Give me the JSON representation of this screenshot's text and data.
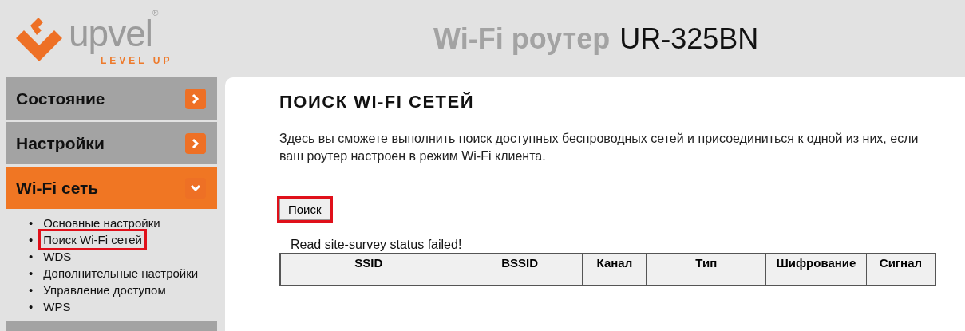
{
  "header": {
    "logo": {
      "name": "upvel",
      "mark": "®",
      "tagline": "LEVEL UP"
    },
    "title": "Wi-Fi роутер",
    "model": "UR-325BN"
  },
  "sidebar": {
    "items": [
      {
        "label": "Состояние",
        "selected": false,
        "expanded": false
      },
      {
        "label": "Настройки",
        "selected": false,
        "expanded": false
      },
      {
        "label": "Wi-Fi сеть",
        "selected": true,
        "expanded": true,
        "bullet": "•",
        "children": [
          {
            "label": "Основные настройки",
            "highlighted": false
          },
          {
            "label": "Поиск Wi-Fi сетей",
            "highlighted": true
          },
          {
            "label": "WDS",
            "highlighted": false
          },
          {
            "label": "Дополнительные настройки",
            "highlighted": false
          },
          {
            "label": "Управление доступом",
            "highlighted": false
          },
          {
            "label": "WPS",
            "highlighted": false
          }
        ]
      }
    ]
  },
  "content": {
    "title": "ПОИСК WI-FI СЕТЕЙ",
    "description": "Здесь вы сможете выполнить поиск доступных беспроводных сетей и присоединиться к одной из них, если ваш роутер настроен в режим Wi-Fi клиента.",
    "search_button": {
      "label": "Поиск",
      "highlighted": true
    },
    "status": "Read site-survey status failed!",
    "table": {
      "columns": [
        "SSID",
        "BSSID",
        "Канал",
        "Тип",
        "Шифрование",
        "Сигнал"
      ]
    }
  }
}
